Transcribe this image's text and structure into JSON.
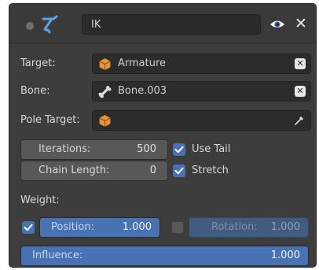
{
  "constraint": {
    "name": "IK",
    "name_placeholder": "IK"
  },
  "fields": {
    "target_label": "Target:",
    "target_value": "Armature",
    "bone_label": "Bone:",
    "bone_value": "Bone.003",
    "pole_label": "Pole Target:",
    "pole_value": ""
  },
  "settings": {
    "iterations_label": "Iterations:",
    "iterations_value": "500",
    "chain_label": "Chain Length:",
    "chain_value": "0",
    "use_tail_label": "Use Tail",
    "use_tail_checked": true,
    "stretch_label": "Stretch",
    "stretch_checked": true
  },
  "weight": {
    "label": "Weight:",
    "position_label": "Position:",
    "position_value": "1.000",
    "position_checked": true,
    "rotation_label": "Rotation:",
    "rotation_value": "1.000",
    "rotation_checked": false
  },
  "influence": {
    "label": "Influence:",
    "value": "1.000",
    "fraction": 1.0
  },
  "colors": {
    "accent": "#4772b3",
    "ik_icon": "#59a3e6",
    "object_icon": "#e8953a"
  }
}
